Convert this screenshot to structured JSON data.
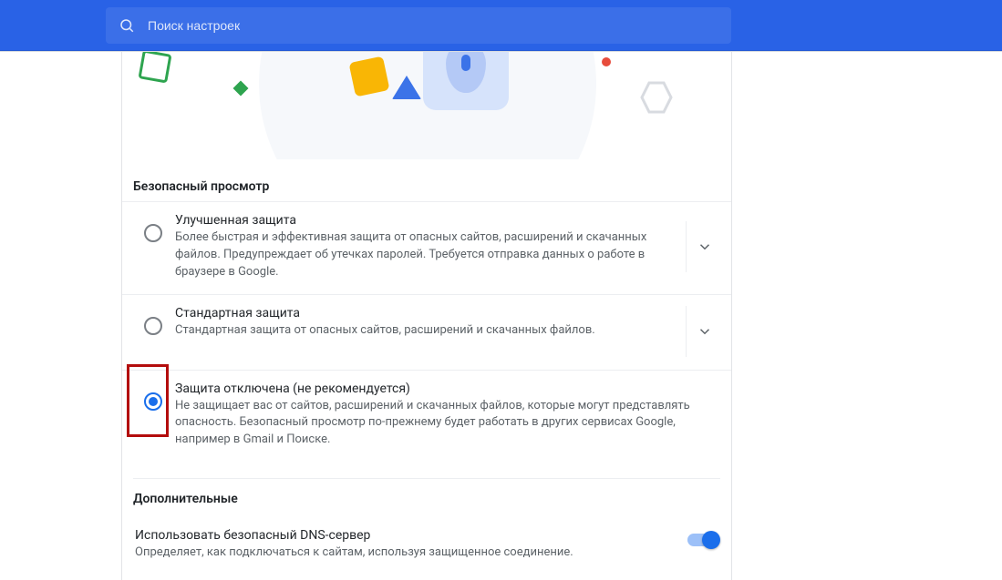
{
  "search": {
    "placeholder": "Поиск настроек"
  },
  "safe_browsing": {
    "section_title": "Безопасный просмотр",
    "options": [
      {
        "title": "Улучшенная защита",
        "desc": "Более быстрая и эффективная защита от опасных сайтов, расширений и скачанных файлов. Предупреждает об утечках паролей. Требуется отправка данных о работе в браузере в Google."
      },
      {
        "title": "Стандартная защита",
        "desc": "Стандартная защита от опасных сайтов, расширений и скачанных файлов."
      },
      {
        "title": "Защита отключена (не рекомендуется)",
        "desc": "Не защищает вас от сайтов, расширений и скачанных файлов, которые могут представлять опасность. Безопасный просмотр по-прежнему будет работать в других сервисах Google, например в Gmail и Поиске."
      }
    ]
  },
  "additional": {
    "title": "Дополнительные",
    "dns_title": "Использовать безопасный DNS-сервер",
    "dns_desc": "Определяет, как подключаться к сайтам, используя защищенное соединение."
  }
}
